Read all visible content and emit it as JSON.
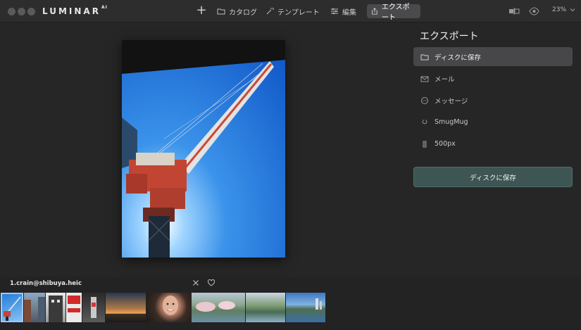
{
  "app": {
    "logo": "LUMINAR",
    "logo_sup": "AI"
  },
  "toolbar": {
    "add_icon": "plus-icon",
    "items": [
      {
        "label": "カタログ",
        "icon": "folder-icon"
      },
      {
        "label": "テンプレート",
        "icon": "magic-wand-icon"
      },
      {
        "label": "編集",
        "icon": "sliders-icon"
      },
      {
        "label": "エクスポート",
        "icon": "share-icon",
        "active": true
      }
    ],
    "zoom": "23%"
  },
  "export_panel": {
    "title": "エクスポート",
    "items": [
      {
        "label": "ディスクに保存",
        "icon": "folder-icon",
        "selected": true
      },
      {
        "label": "メール",
        "icon": "mail-icon"
      },
      {
        "label": "メッセージ",
        "icon": "message-icon"
      },
      {
        "label": "SmugMug",
        "icon": "smugmug-icon"
      },
      {
        "label": "500px",
        "icon": "500px-icon"
      }
    ],
    "save_button": "ディスクに保存"
  },
  "filmstrip": {
    "filename": "1.crain@shibuya.heic",
    "reject_icon": "close-icon",
    "favorite_icon": "heart-icon",
    "thumbnails": [
      "crane",
      "street",
      "building",
      "sign",
      "shop",
      "sunset",
      "portrait",
      "park",
      "river",
      "lake"
    ]
  }
}
